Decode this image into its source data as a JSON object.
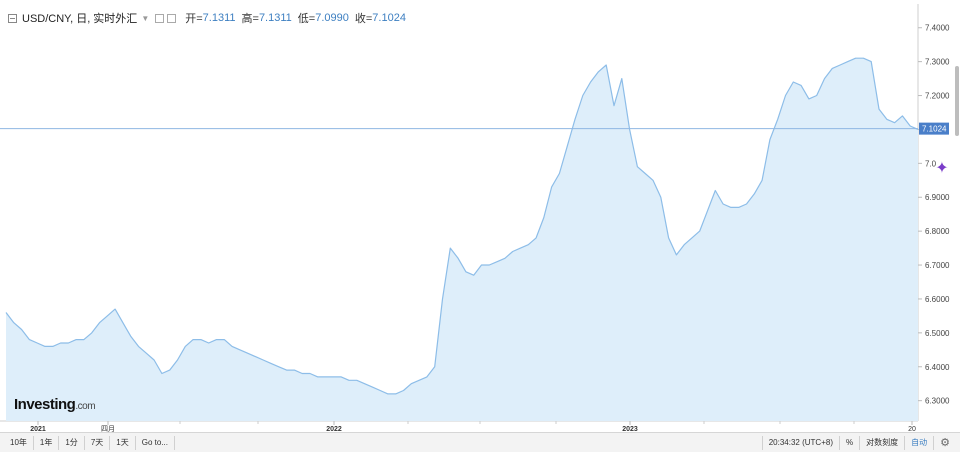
{
  "legend": {
    "symbol": "USD/CNY, 日, 实时外汇",
    "open_label": "开=",
    "open": "7.1311",
    "high_label": "高=",
    "high": "7.1311",
    "low_label": "低=",
    "low": "7.0990",
    "close_label": "收=",
    "close": "7.1024"
  },
  "watermark": {
    "brand": "Investing",
    "suffix": ".com"
  },
  "toolbar": {
    "ranges": [
      "10年",
      "1年",
      "1分",
      "7天",
      "1天",
      "Go to..."
    ],
    "time": "20:34:32 (UTC+8)",
    "percent": "%",
    "scale_mode": "对数刻度",
    "auto": "自动"
  },
  "colors": {
    "line": "#8dbde8",
    "fill": "#deeefa",
    "price_tag": "#4a7fc9",
    "accent": "#3d7fc1"
  },
  "chart_data": {
    "type": "area",
    "series": [
      {
        "name": "USD/CNY",
        "values": [
          6.56,
          6.53,
          6.51,
          6.48,
          6.47,
          6.46,
          6.46,
          6.47,
          6.47,
          6.48,
          6.48,
          6.5,
          6.53,
          6.55,
          6.57,
          6.53,
          6.49,
          6.46,
          6.44,
          6.42,
          6.38,
          6.39,
          6.42,
          6.46,
          6.48,
          6.48,
          6.47,
          6.48,
          6.48,
          6.46,
          6.45,
          6.44,
          6.43,
          6.42,
          6.41,
          6.4,
          6.39,
          6.39,
          6.38,
          6.38,
          6.37,
          6.37,
          6.37,
          6.37,
          6.36,
          6.36,
          6.35,
          6.34,
          6.33,
          6.32,
          6.32,
          6.33,
          6.35,
          6.36,
          6.37,
          6.4,
          6.6,
          6.75,
          6.72,
          6.68,
          6.67,
          6.7,
          6.7,
          6.71,
          6.72,
          6.74,
          6.75,
          6.76,
          6.78,
          6.84,
          6.93,
          6.97,
          7.05,
          7.13,
          7.2,
          7.24,
          7.27,
          7.29,
          7.17,
          7.25,
          7.1,
          6.99,
          6.97,
          6.95,
          6.9,
          6.78,
          6.73,
          6.76,
          6.78,
          6.8,
          6.86,
          6.92,
          6.88,
          6.87,
          6.87,
          6.88,
          6.91,
          6.95,
          7.07,
          7.13,
          7.2,
          7.24,
          7.23,
          7.19,
          7.2,
          7.25,
          7.28,
          7.29,
          7.3,
          7.31,
          7.31,
          7.3,
          7.16,
          7.13,
          7.12,
          7.14,
          7.11,
          7.1
        ]
      }
    ],
    "x_tick_labels": [
      "2021",
      "四月",
      "2022",
      "2023",
      "20"
    ],
    "y_ticks": [
      6.3,
      6.4,
      6.5,
      6.6,
      6.7,
      6.8,
      6.9,
      7.0,
      7.1,
      7.2,
      7.3,
      7.4
    ],
    "y_tick_labels": [
      "6.3000",
      "6.4000",
      "6.5000",
      "6.6000",
      "6.7000",
      "6.8000",
      "6.9000",
      "7.0",
      "",
      "7.2000",
      "7.3000",
      "7.4000"
    ],
    "ylim": [
      6.24,
      7.47
    ],
    "current_price": 7.1024,
    "current_price_label": "7.1024",
    "grid": false,
    "scale": "linear"
  }
}
